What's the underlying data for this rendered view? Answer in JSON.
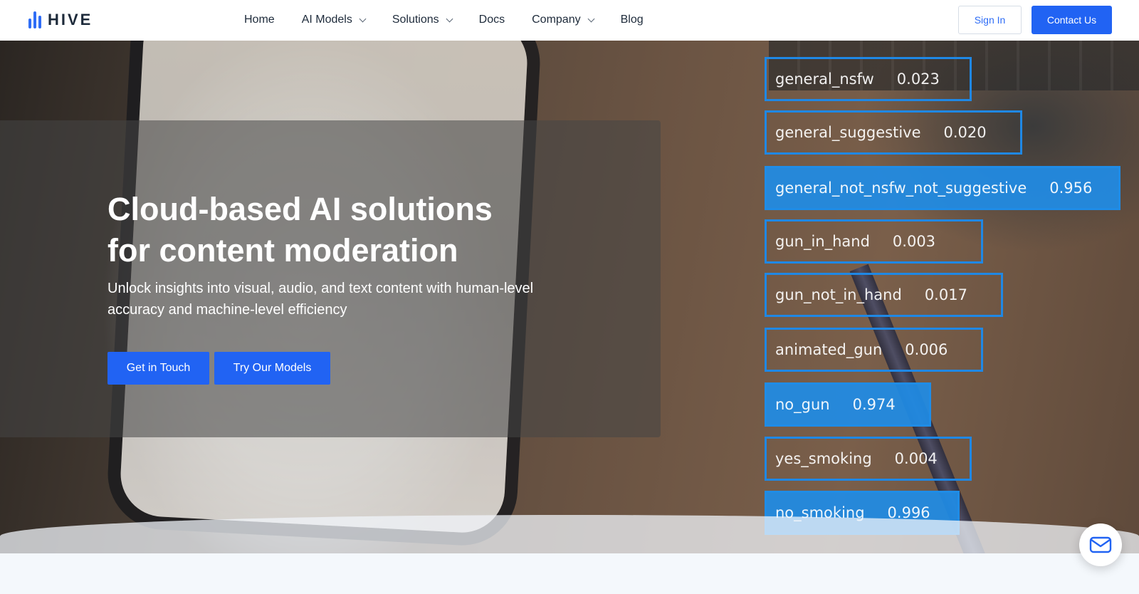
{
  "header": {
    "logo_text": "HIVE",
    "nav": [
      {
        "label": "Home",
        "has_dropdown": false
      },
      {
        "label": "AI Models",
        "has_dropdown": true
      },
      {
        "label": "Solutions",
        "has_dropdown": true
      },
      {
        "label": "Docs",
        "has_dropdown": false
      },
      {
        "label": "Company",
        "has_dropdown": true
      },
      {
        "label": "Blog",
        "has_dropdown": false
      }
    ],
    "sign_in": "Sign In",
    "contact": "Contact Us"
  },
  "hero": {
    "title_line1": "Cloud-based AI solutions",
    "title_line2": "for content moderation",
    "subtitle": "Unlock insights into visual, audio, and text content with human-level accuracy and machine-level efficiency",
    "cta_primary": "Get in Touch",
    "cta_secondary": "Try Our Models"
  },
  "labels": [
    {
      "name": "general_nsfw",
      "score": "0.023",
      "highlight": false
    },
    {
      "name": "general_suggestive",
      "score": "0.020",
      "highlight": false
    },
    {
      "name": "general_not_nsfw_not_suggestive",
      "score": "0.956",
      "highlight": true
    },
    {
      "name": "gun_in_hand",
      "score": "0.003",
      "highlight": false
    },
    {
      "name": "gun_not_in_hand",
      "score": "0.017",
      "highlight": false
    },
    {
      "name": "animated_gun",
      "score": "0.006",
      "highlight": false
    },
    {
      "name": "no_gun",
      "score": "0.974",
      "highlight": true
    },
    {
      "name": "yes_smoking",
      "score": "0.004",
      "highlight": false
    },
    {
      "name": "no_smoking",
      "score": "0.996",
      "highlight": true
    }
  ],
  "colors": {
    "accent": "#2163f3",
    "label_blue": "#1f88e5",
    "text_dark": "#1d2a3a"
  },
  "icons": {
    "mail": "mail-icon",
    "chevron": "chevron-down-icon"
  }
}
